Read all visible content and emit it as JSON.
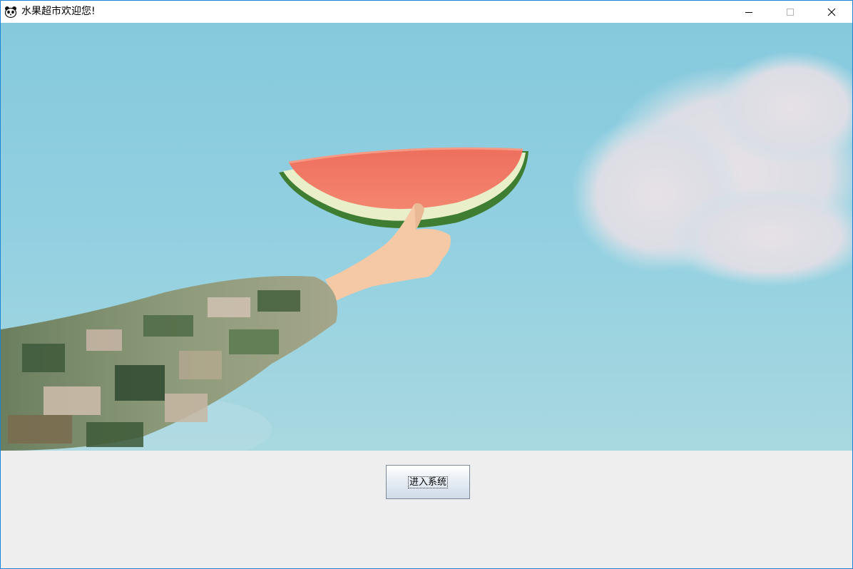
{
  "window": {
    "title": "水果超市欢迎您!",
    "frame_color": "#1883d7"
  },
  "titlebar": {
    "app_icon": "panda-icon",
    "controls": [
      "minimize-icon",
      "maximize-icon",
      "close-icon"
    ]
  },
  "main": {
    "image": "watermelon-sky-photo"
  },
  "actions": {
    "enter_label": "进入系统"
  },
  "colors": {
    "sky": "#8fd0e2",
    "watermelon_flesh": "#f0705a",
    "rind": "#4e8a3a",
    "panel_bg": "#eeeeee"
  }
}
